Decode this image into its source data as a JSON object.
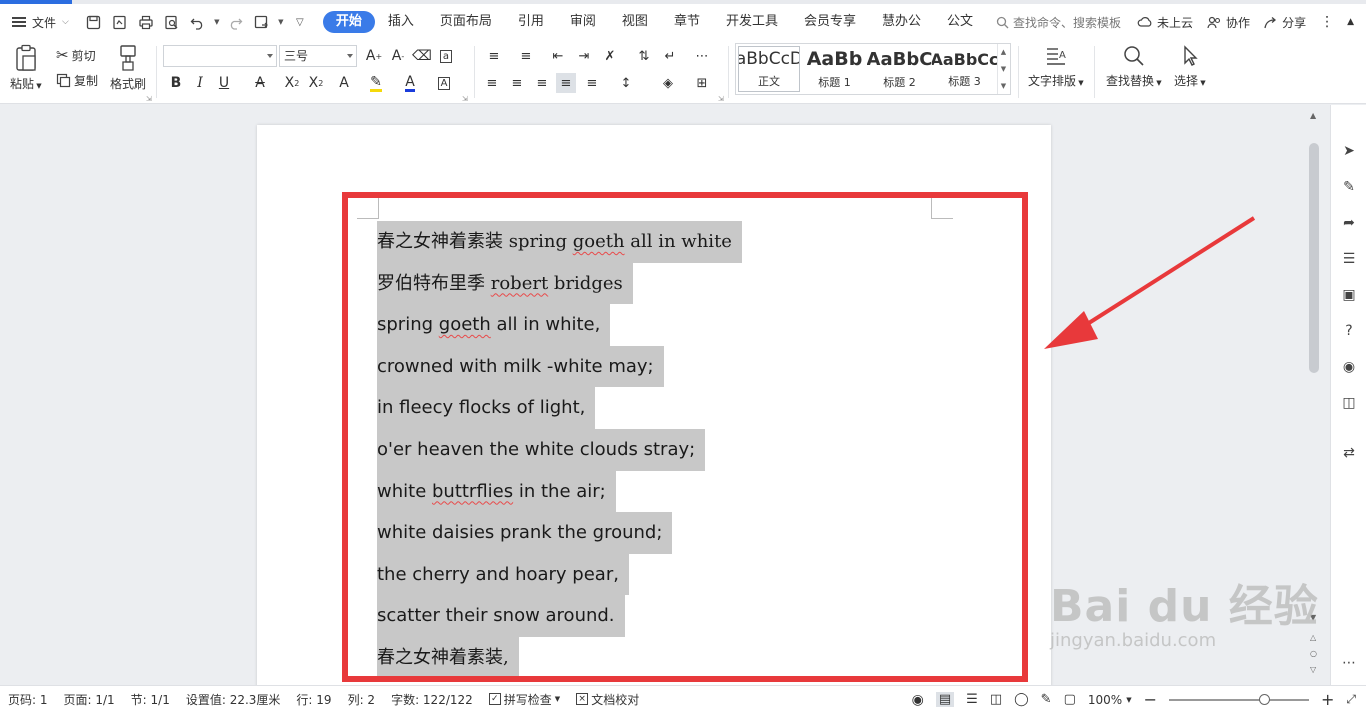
{
  "menu": {
    "file_label": "文件",
    "tabs": [
      "开始",
      "插入",
      "页面布局",
      "引用",
      "审阅",
      "视图",
      "章节",
      "开发工具",
      "会员专享",
      "慧办公",
      "公文"
    ],
    "active_tab": "开始",
    "search_placeholder": "查找命令、搜索模板",
    "cloud_label": "未上云",
    "collab_label": "协作",
    "share_label": "分享"
  },
  "ribbon": {
    "paste_label": "粘贴",
    "cut_label": "剪切",
    "copy_label": "复制",
    "format_painter_label": "格式刷",
    "font_name": "",
    "font_size": "三号",
    "styles": [
      {
        "sample": "AaBbCcDd",
        "label": "正文"
      },
      {
        "sample": "AaBb",
        "label": "标题 1"
      },
      {
        "sample": "AaBbC",
        "label": "标题 2"
      },
      {
        "sample": "AaBbCc",
        "label": "标题 3"
      }
    ],
    "text_layout_label": "文字排版",
    "find_replace_label": "查找替换",
    "select_label": "选择"
  },
  "document": {
    "lines": [
      {
        "text": "春之女神着素装 ",
        "rest": "spring ",
        "sq": "goeth",
        "tail": " all in white",
        "cn": true
      },
      {
        "text": "罗伯特布里季 ",
        "rest": "",
        "sq": "robert",
        "tail": " bridges",
        "cn": true
      },
      {
        "text": "",
        "rest": "spring ",
        "sq": "goeth",
        "tail": " all in white,",
        "cn": false
      },
      {
        "text": "",
        "rest": "crowned with milk -white may;",
        "sq": "",
        "tail": "",
        "cn": false
      },
      {
        "text": "",
        "rest": "in fleecy flocks of light,",
        "sq": "",
        "tail": "",
        "cn": false
      },
      {
        "text": "",
        "rest": "o'er heaven the white clouds stray;",
        "sq": "",
        "tail": "",
        "cn": false
      },
      {
        "text": "",
        "rest": "white ",
        "sq": "buttrflies",
        "tail": " in the air;",
        "cn": false
      },
      {
        "text": "",
        "rest": "white daisies prank the ground;",
        "sq": "",
        "tail": "",
        "cn": false
      },
      {
        "text": "",
        "rest": "the cherry and hoary pear,",
        "sq": "",
        "tail": "",
        "cn": false
      },
      {
        "text": "",
        "rest": "scatter their snow around.",
        "sq": "",
        "tail": "",
        "cn": false
      },
      {
        "text": "春之女神着素装,",
        "rest": "",
        "sq": "",
        "tail": "",
        "cn": true
      }
    ]
  },
  "status": {
    "page_code": "页码: 1",
    "page": "页面: 1/1",
    "section": "节: 1/1",
    "setting": "设置值: 22.3厘米",
    "row": "行: 19",
    "col": "列: 2",
    "word_count": "字数: 122/122",
    "spell_check": "拼写检查",
    "doc_proof": "文档校对",
    "zoom": "100%"
  },
  "watermark": {
    "brand": "Bai du 经验",
    "url": "jingyan.baidu.com"
  },
  "colors": {
    "accent": "#3a7be8",
    "highlight": "#c8c8c8",
    "annotation_red": "#e8393b"
  }
}
